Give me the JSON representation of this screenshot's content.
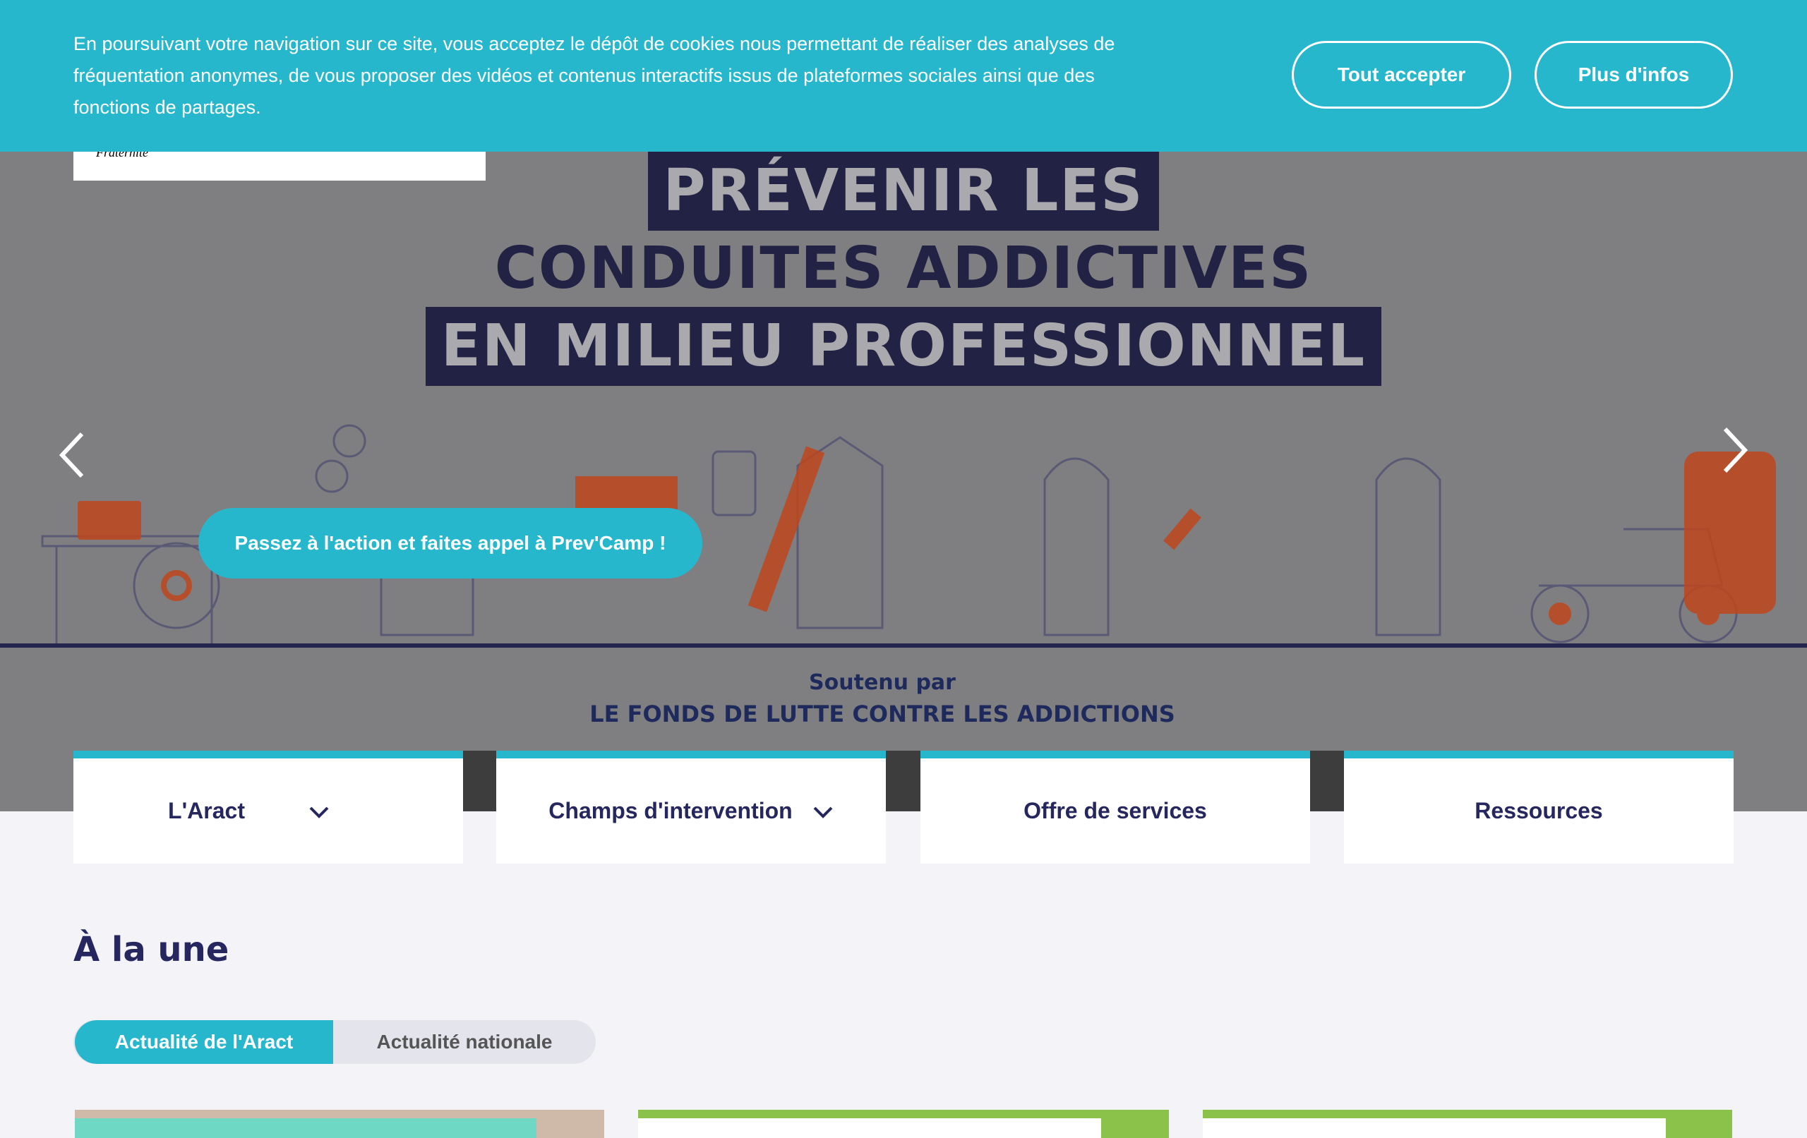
{
  "cookie_banner": {
    "text": "En poursuivant votre navigation sur ce site, vous acceptez le dépôt de cookies nous permettant de réaliser des analyses de fréquentation anonymes, de vous proposer des vidéos et contenus interactifs issus de plateformes sociales ainsi que des fonctions de partages.",
    "accept_label": "Tout accepter",
    "info_label": "Plus d'infos"
  },
  "logo": {
    "text": "Fraternité"
  },
  "hero": {
    "title_line1": "PRÉVENIR LES",
    "title_line2": "CONDUITES ADDICTIVES",
    "title_line3": "EN MILIEU PROFESSIONNEL",
    "support_line1": "Soutenu par",
    "support_line2": "LE FONDS DE LUTTE CONTRE LES ADDICTIONS",
    "cta_label": "Passez à l'action et faites appel à Prev'Camp !"
  },
  "nav": {
    "items": [
      {
        "label": "L'Aract",
        "has_dropdown": true
      },
      {
        "label": "Champs d'intervention",
        "has_dropdown": true
      },
      {
        "label": "Offre de services",
        "has_dropdown": false
      },
      {
        "label": "Ressources",
        "has_dropdown": false
      }
    ]
  },
  "news": {
    "title": "À la une",
    "tabs": [
      {
        "label": "Actualité de l'Aract",
        "active": true
      },
      {
        "label": "Actualité nationale",
        "active": false
      }
    ]
  },
  "colors": {
    "accent": "#27b7cd",
    "navy": "#25275e",
    "card_green": "#8bc34a"
  }
}
